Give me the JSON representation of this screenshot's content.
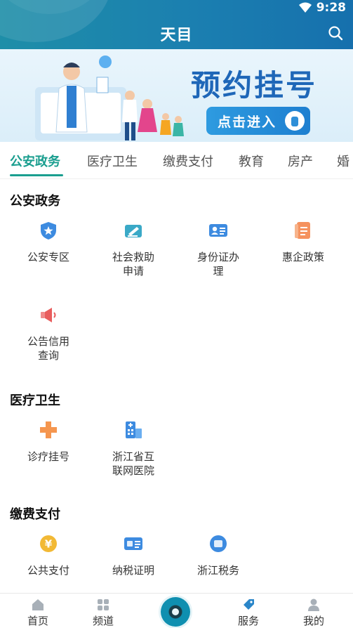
{
  "status_bar": {
    "time": "9:28"
  },
  "header": {
    "title": "天目"
  },
  "banner": {
    "heading": "预约挂号",
    "button": "点击进入"
  },
  "tabs": [
    "公安政务",
    "医疗卫生",
    "缴费支付",
    "教育",
    "房产",
    "婚"
  ],
  "sections": [
    {
      "title": "公安政务",
      "items": [
        "公安专区",
        "社会救助申请",
        "身份证办理",
        "惠企政策",
        "公告信用查询"
      ]
    },
    {
      "title": "医疗卫生",
      "items": [
        "诊疗挂号",
        "浙江省互联网医院"
      ]
    },
    {
      "title": "缴费支付",
      "items": [
        "公共支付",
        "纳税证明",
        "浙江税务"
      ]
    }
  ],
  "bottom_nav": [
    "首页",
    "频道",
    "服务",
    "我的"
  ],
  "colors": {
    "accent": "#1a9e8f",
    "header": "#1b7fb0"
  }
}
